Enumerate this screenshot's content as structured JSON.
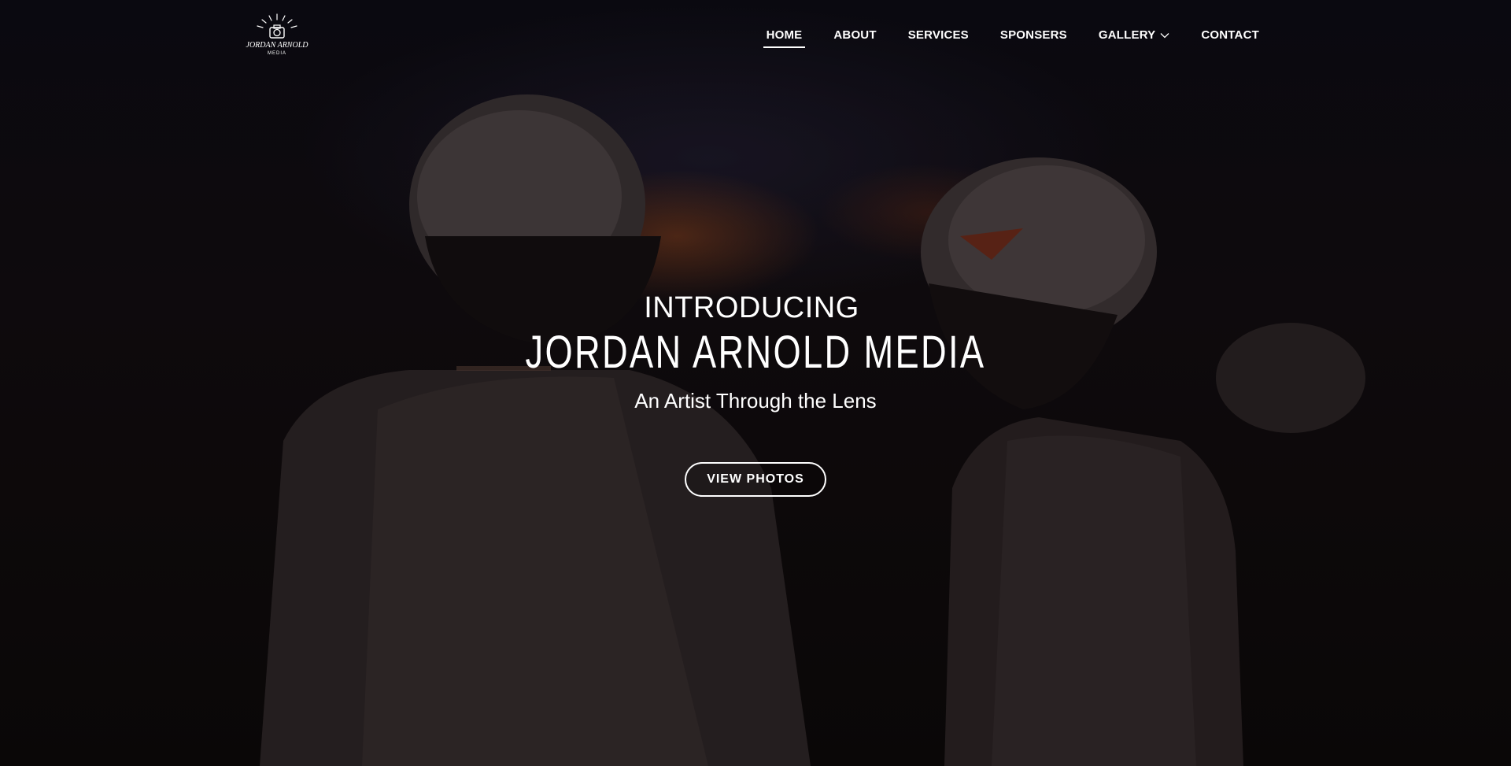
{
  "brand": {
    "logo_text": "JORDAN ARNOLD",
    "logo_subtext": "MEDIA",
    "logo_icon": "camera-icon"
  },
  "nav": {
    "items": [
      {
        "label": "HOME",
        "active": true
      },
      {
        "label": "ABOUT",
        "active": false
      },
      {
        "label": "SERVICES",
        "active": false
      },
      {
        "label": "SPONSERS",
        "active": false
      },
      {
        "label": "GALLERY",
        "active": false,
        "dropdown": true
      },
      {
        "label": "CONTACT",
        "active": false
      }
    ]
  },
  "hero": {
    "intro": "INTRODUCING",
    "title": "JORDAN ARNOLD MEDIA",
    "tagline": "An Artist Through the Lens",
    "cta_label": "VIEW PHOTOS"
  },
  "colors": {
    "text": "#ffffff",
    "background": "#0b0808",
    "sunset_glow": "#964619"
  }
}
